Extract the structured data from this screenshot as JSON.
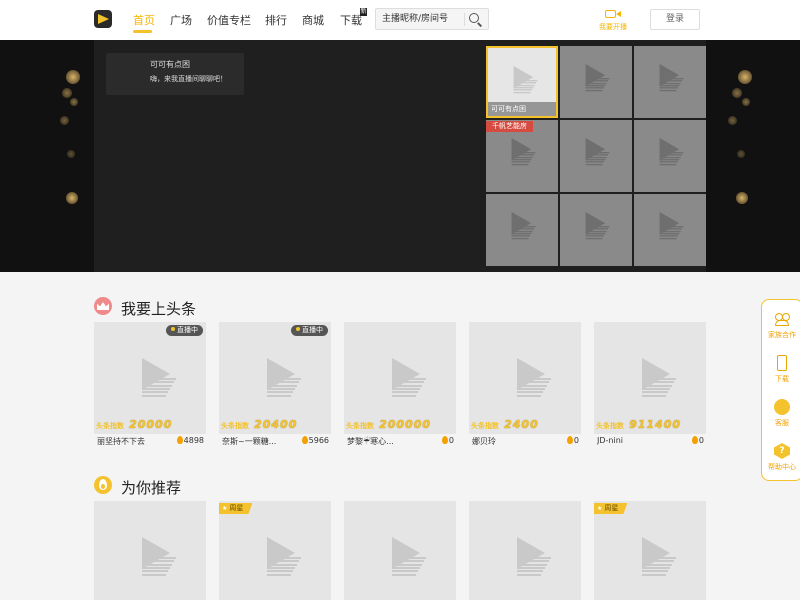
{
  "header": {
    "nav": [
      {
        "label": "首页",
        "active": true
      },
      {
        "label": "广场"
      },
      {
        "label": "价值专栏"
      },
      {
        "label": "排行"
      },
      {
        "label": "商城"
      },
      {
        "label": "下载",
        "badge": "新"
      }
    ],
    "search": {
      "placeholder": "主播昵称/房间号",
      "icon": "search-icon"
    },
    "go_live_label": "我要开播",
    "login_label": "登录"
  },
  "hero": {
    "streamer_name": "可可有点困",
    "streamer_message": "嗨，来我直播间聊聊吧！",
    "tiles": [
      {
        "caption": "可可有点困",
        "active": true
      },
      {
        "caption": ""
      },
      {
        "caption": ""
      },
      {
        "caption": "",
        "ribbon": "千帆艺能房"
      },
      {
        "caption": ""
      },
      {
        "caption": ""
      },
      {
        "caption": ""
      },
      {
        "caption": ""
      },
      {
        "caption": ""
      }
    ]
  },
  "headline": {
    "title": "我要上头条",
    "index_label": "头条指数",
    "live_label": "直播中",
    "cards": [
      {
        "name": "丽坚持不下去",
        "index": "20000",
        "heat": "4898",
        "live": true
      },
      {
        "name": "奈斯~一颗糖...",
        "index": "20400",
        "heat": "5966",
        "live": true
      },
      {
        "name": "梦黎☔寒心...",
        "index": "200000",
        "heat": "0",
        "live": false
      },
      {
        "name": "娜贝玲",
        "index": "2400",
        "heat": "0",
        "live": false
      },
      {
        "name": "JD-nini",
        "index": "911400",
        "heat": "0",
        "live": false
      }
    ]
  },
  "recommend": {
    "title": "为你推荐",
    "week_star_label": "周星",
    "cards": [
      {
        "week_star": false
      },
      {
        "week_star": true
      },
      {
        "week_star": false
      },
      {
        "week_star": false
      },
      {
        "week_star": true
      }
    ]
  },
  "float_bar": {
    "items": [
      {
        "label": "家族合作",
        "icon": "family-icon"
      },
      {
        "label": "下载",
        "icon": "phone-icon"
      },
      {
        "label": "客服",
        "icon": "chat-icon"
      },
      {
        "label": "帮助中心",
        "icon": "help-icon"
      }
    ]
  },
  "colors": {
    "accent": "#f4c22c",
    "hero_bg": "#1f1f1f",
    "ribbon": "#d54b3f"
  }
}
